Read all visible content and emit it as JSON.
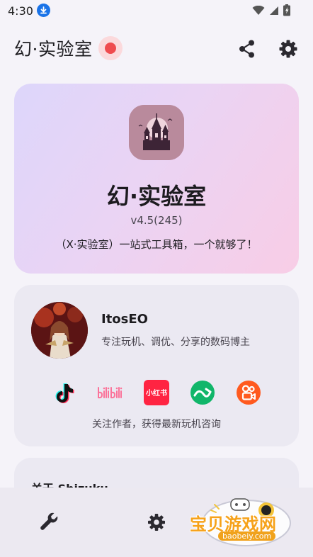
{
  "status_bar": {
    "time": "4:30"
  },
  "app_bar": {
    "title": "幻·实验室"
  },
  "hero": {
    "name": "幻·实验室",
    "version": "v4.5(245)",
    "description": "（X·实验室）一站式工具箱，一个就够了！"
  },
  "author": {
    "name": "ItosEO",
    "bio": "专注玩机、调优、分享的数码博主",
    "follow_text": "关注作者，获得最新玩机咨询",
    "socials": [
      {
        "icon": "tiktok-icon",
        "color": "#111111"
      },
      {
        "icon": "bilibili-icon",
        "color": "#fb7299"
      },
      {
        "icon": "xiaohongshu-icon",
        "label": "小红书",
        "color": "#ff2442"
      },
      {
        "icon": "coolapk-icon",
        "color": "#11b66a"
      },
      {
        "icon": "kuaishou-icon",
        "color": "#ff5a1f"
      }
    ]
  },
  "shizuku": {
    "title": "关于 Shizuku"
  },
  "watermark": {
    "text": "宝贝游戏网",
    "url": "baobeiy.com"
  },
  "colors": {
    "accent_red": "#ef4b4f",
    "hero_gradient_start": "#ddd6fb",
    "hero_gradient_end": "#f8cde6",
    "card_bg": "#ebe9f2"
  }
}
